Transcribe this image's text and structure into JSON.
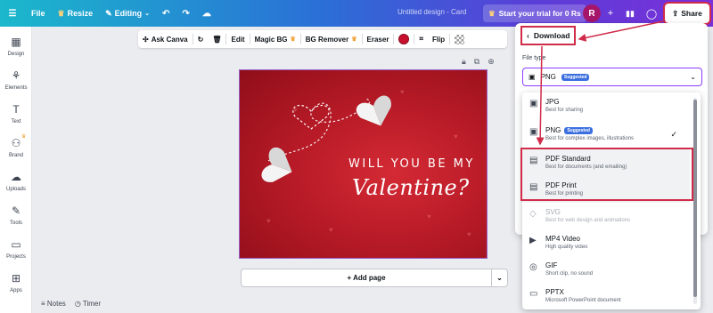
{
  "topbar": {
    "file": "File",
    "resize": "Resize",
    "editing": "Editing",
    "doc_title": "Untitled design - Card",
    "trial": "Start your trial for 0 Rs",
    "avatar": "R",
    "share": "Share"
  },
  "sidebar": {
    "items": [
      {
        "label": "Design",
        "icon": "design-icon"
      },
      {
        "label": "Elements",
        "icon": "elements-icon"
      },
      {
        "label": "Text",
        "icon": "text-icon"
      },
      {
        "label": "Brand",
        "icon": "brand-icon"
      },
      {
        "label": "Uploads",
        "icon": "uploads-icon"
      },
      {
        "label": "Tools",
        "icon": "tools-icon"
      },
      {
        "label": "Projects",
        "icon": "projects-icon"
      },
      {
        "label": "Apps",
        "icon": "apps-icon"
      }
    ]
  },
  "toolbar": {
    "ask": "Ask Canva",
    "edit": "Edit",
    "magic_bg": "Magic BG",
    "bg_remover": "BG Remover",
    "eraser": "Eraser",
    "flip": "Flip",
    "color": "#c8102e"
  },
  "design": {
    "headline": "WILL YOU BE MY",
    "script": "Valentine?"
  },
  "add_page": "+ Add page",
  "bottom": {
    "notes": "Notes",
    "timer": "Timer"
  },
  "download": {
    "title": "Download",
    "file_type_label": "File type",
    "selected": "PNG",
    "suggested": "Suggested",
    "options": [
      {
        "name": "JPG",
        "desc": "Best for sharing"
      },
      {
        "name": "PNG",
        "desc": "Best for complex images, illustrations",
        "badge": "Suggested"
      },
      {
        "name": "PDF Standard",
        "desc": "Best for documents (and emailing)"
      },
      {
        "name": "PDF Print",
        "desc": "Best for printing"
      },
      {
        "name": "SVG",
        "desc": "Best for web design and animations"
      },
      {
        "name": "MP4 Video",
        "desc": "High quality video"
      },
      {
        "name": "GIF",
        "desc": "Short clip, no sound"
      },
      {
        "name": "PPTX",
        "desc": "Microsoft PowerPoint document"
      }
    ]
  },
  "colors": {
    "accent": "#8b3dff",
    "annotation": "#d02c4a",
    "card": "#b81b27"
  }
}
